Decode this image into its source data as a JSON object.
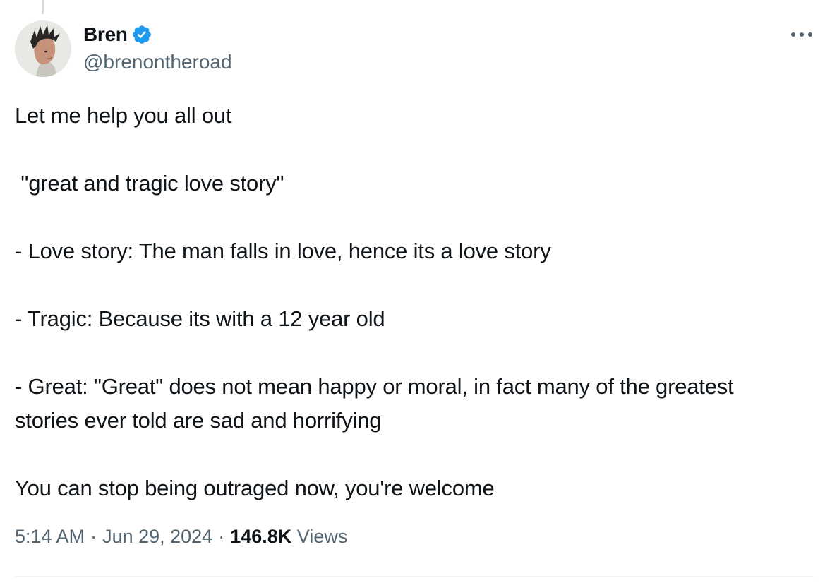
{
  "author": {
    "display_name": "Bren",
    "handle": "@brenontheroad",
    "avatar_icon": "profile-photo",
    "verified_icon": "verified-badge-icon",
    "verified_color": "#1d9bf0"
  },
  "menu_icon": "more-horizontal-icon",
  "tweet": {
    "lines": [
      "Let me help you all out",
      " \"great and tragic love story\"",
      "- Love story: The man falls in love, hence its a love story",
      "- Tragic: Because its with a 12 year old",
      "- Great: \"Great\" does not mean happy or moral, in fact many of the greatest stories ever told are sad and horrifying",
      "You can stop being outraged now, you're welcome"
    ]
  },
  "meta": {
    "time": "5:14 AM",
    "separator": "·",
    "date": "Jun 29, 2024",
    "views_count": "146.8K",
    "views_label": "Views"
  },
  "colors": {
    "text_primary": "#0f1419",
    "text_secondary": "#536471",
    "accent": "#1d9bf0"
  }
}
